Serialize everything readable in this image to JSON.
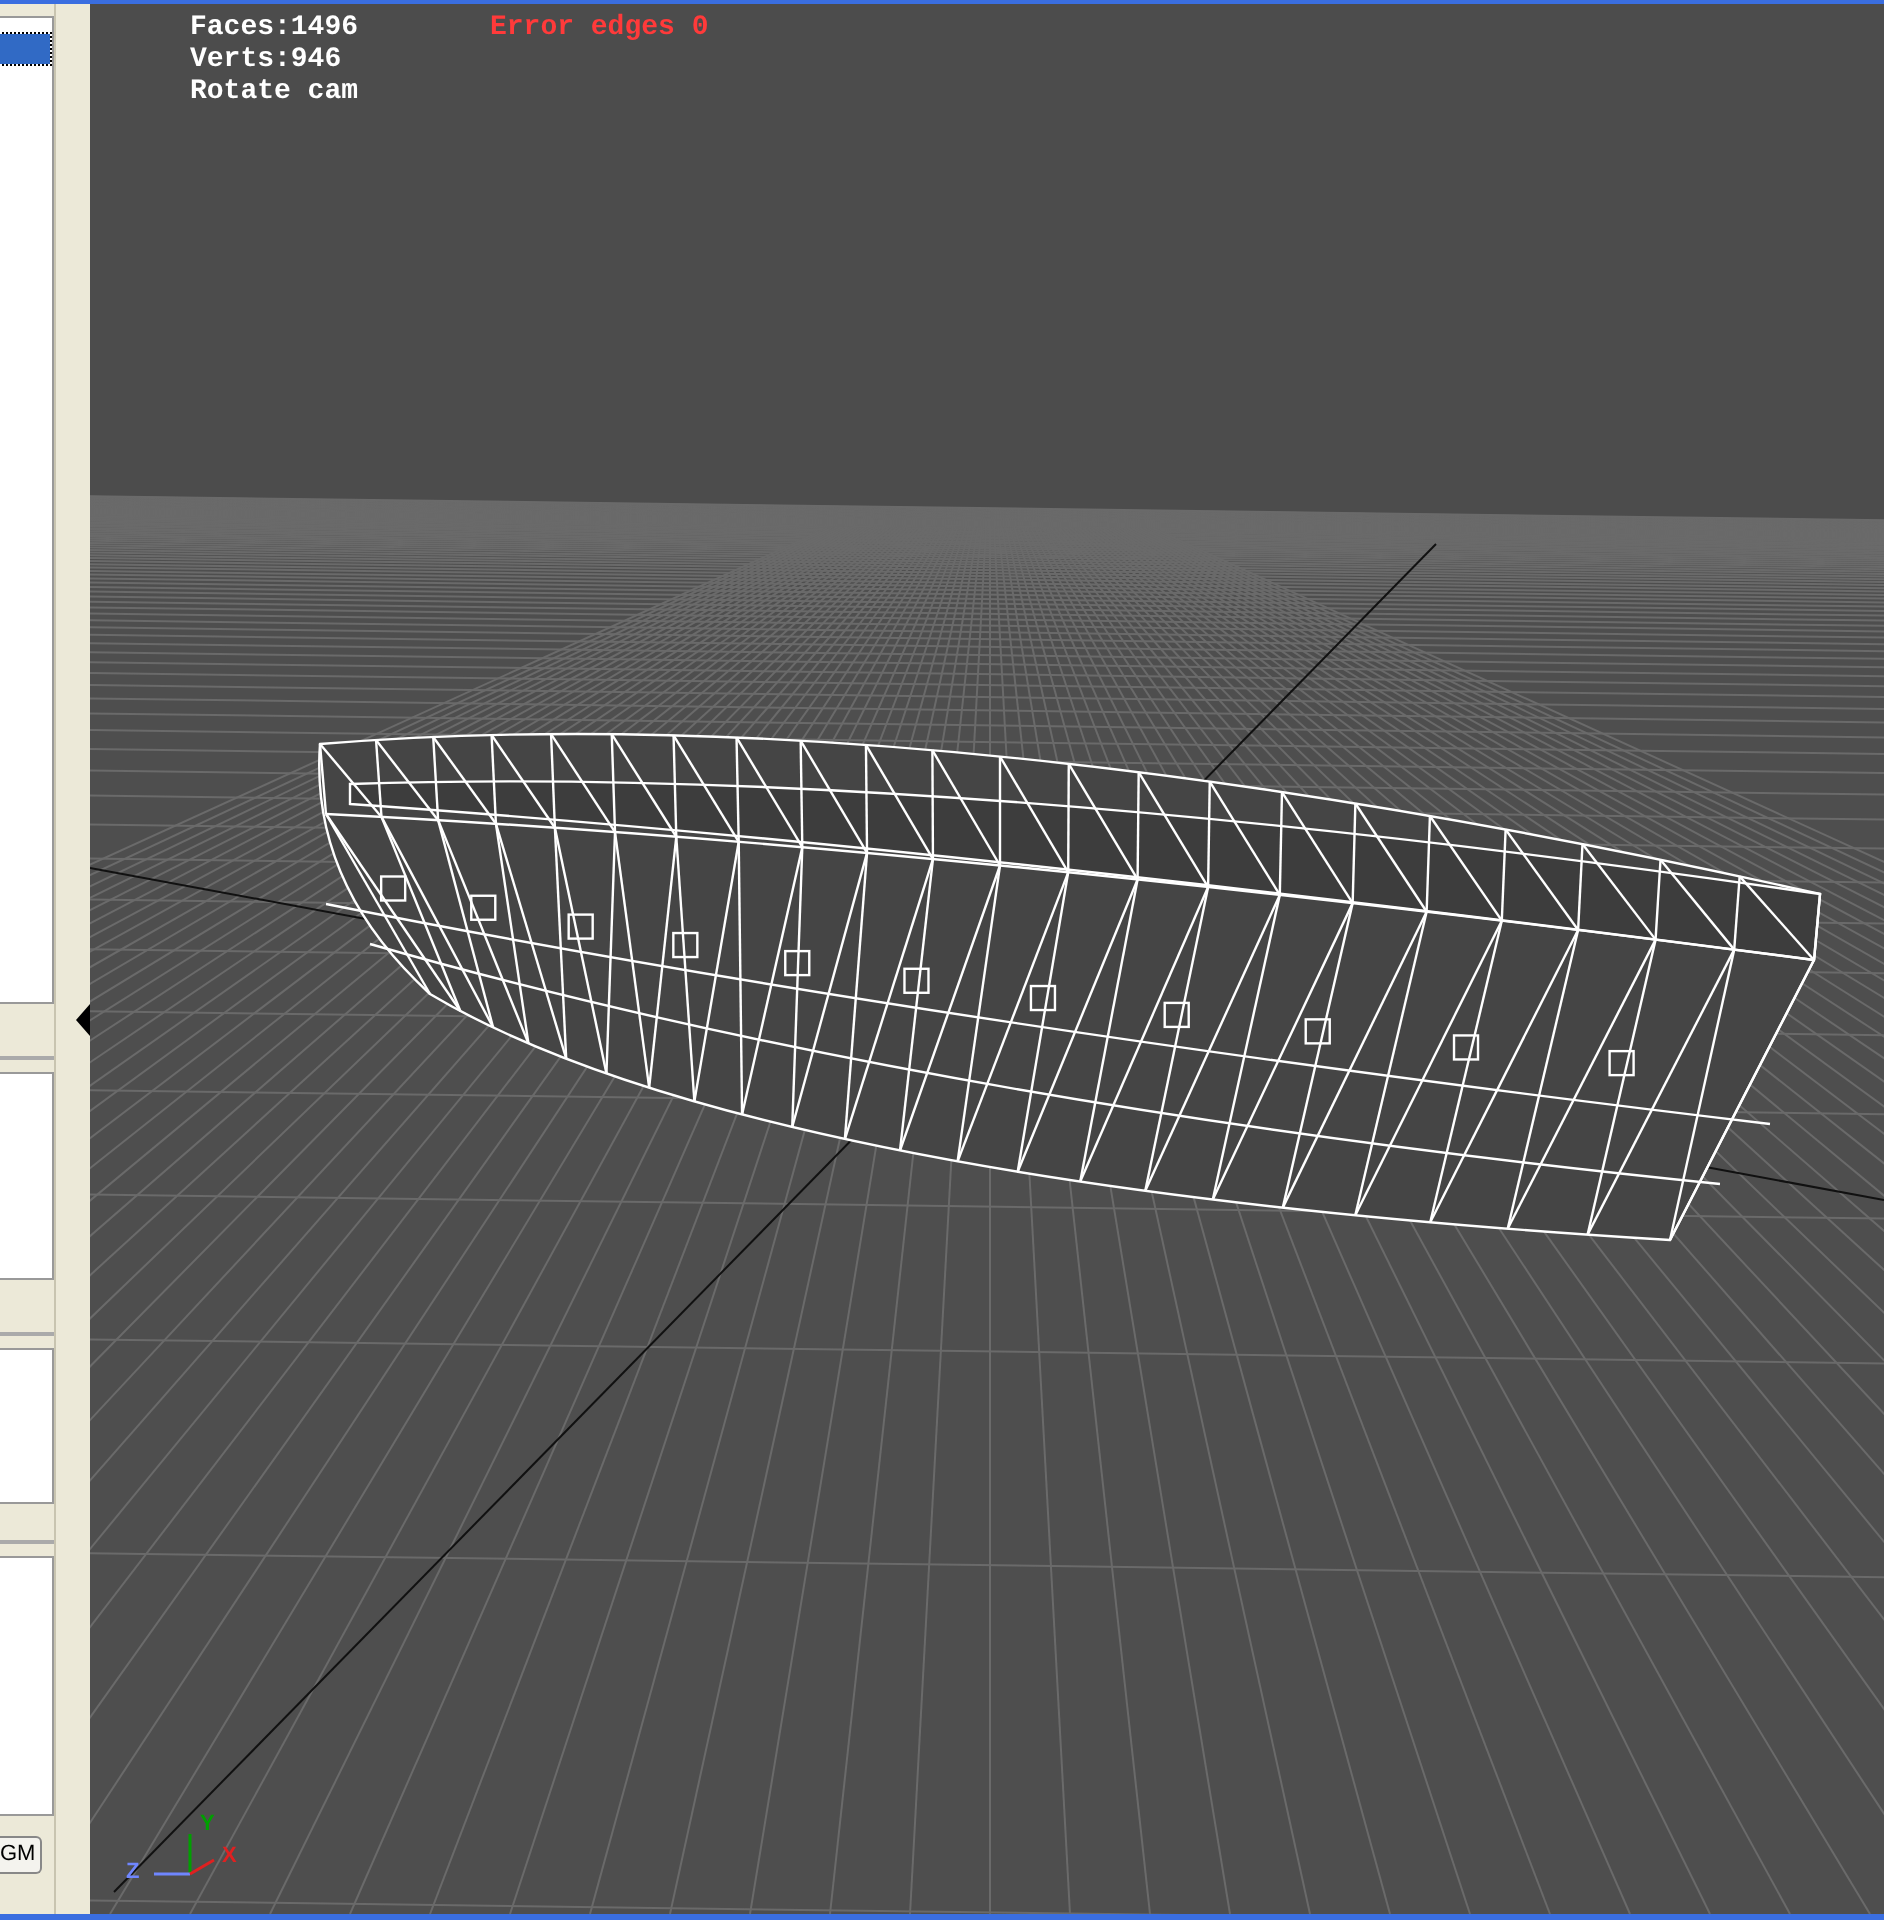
{
  "sidebar": {
    "list": {
      "items": [
        {
          "selected": true
        }
      ]
    },
    "button": {
      "label": "GM"
    }
  },
  "viewport": {
    "stats": [
      "Faces:1496",
      "Verts:946",
      "Rotate cam"
    ],
    "error": "Error edges 0",
    "axes": [
      {
        "label": "Y",
        "color": "#00a000"
      },
      {
        "label": "Z",
        "color": "#6f86ff"
      },
      {
        "label": "X",
        "color": "#e02020"
      }
    ]
  }
}
